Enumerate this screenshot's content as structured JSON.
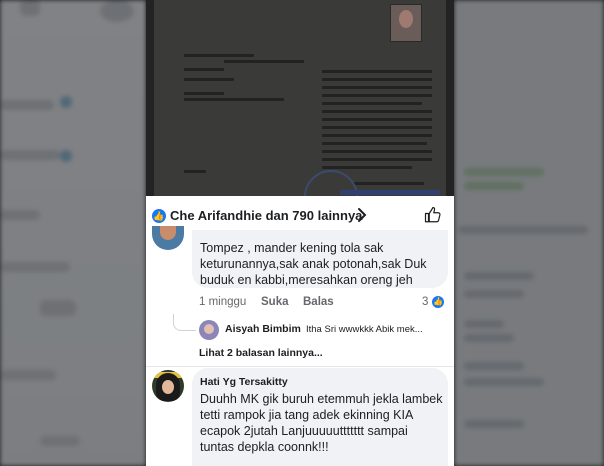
{
  "post": {
    "reactions_text": "Che Arifandhie dan 790 lainnya"
  },
  "comments": [
    {
      "text": "Tompez , mander kening tola sak keturunannya,sak anak potonah,sak Duk buduk en kabbi,meresahkan oreng jeh",
      "time": "1 minggu",
      "like_label": "Suka",
      "reply_label": "Balas",
      "like_count": "3",
      "reply_preview": {
        "author": "Aisyah Bimbim",
        "text": "Itha Sri wwwkkk Abik mek..."
      },
      "more_replies": "Lihat 2 balasan lainnya..."
    },
    {
      "author": "Hati Yg Tersakitty",
      "text": "Duuhh MK gik buruh etemmuh jekla lambek tetti rampok jia tang adek ekinning KIA ecapok 2jutah Lanjuuuuuttttttt sampai tuntas depkla coonnk!!!"
    }
  ],
  "colors": {
    "facebook_blue": "#1877f2",
    "bubble_bg": "#f0f2f5",
    "meta_text": "#65676b"
  }
}
